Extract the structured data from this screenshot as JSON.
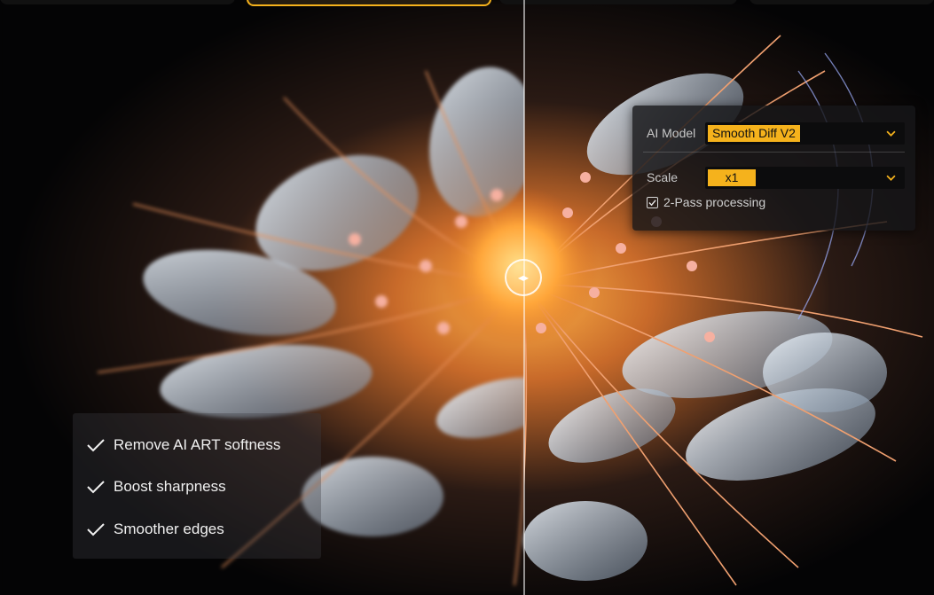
{
  "settings": {
    "ai_model_label": "AI Model",
    "ai_model_value": "Smooth Diff V2",
    "scale_label": "Scale",
    "scale_value": "x1",
    "two_pass_label": "2-Pass processing",
    "two_pass_checked": true
  },
  "features": [
    "Remove AI ART softness",
    "Boost sharpness",
    "Smoother edges"
  ],
  "colors": {
    "accent": "#f5b21c",
    "panel": "#161618",
    "text": "#cfcfcf"
  },
  "icons": {
    "slider_handle": "left-right-arrows-icon",
    "dropdown": "chevron-down-icon",
    "feature": "checkmark-icon",
    "checkbox": "checkbox-checked-icon"
  }
}
